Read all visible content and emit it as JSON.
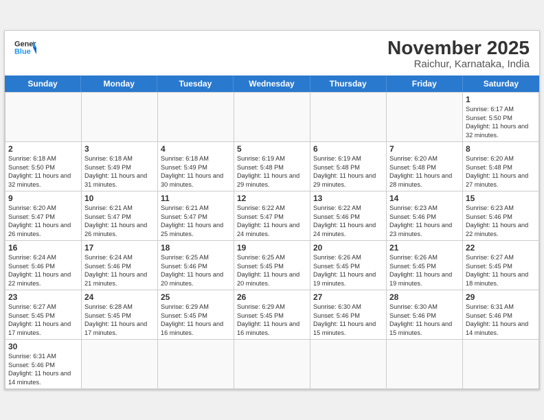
{
  "header": {
    "logo_general": "General",
    "logo_blue": "Blue",
    "month": "November 2025",
    "location": "Raichur, Karnataka, India"
  },
  "days": [
    "Sunday",
    "Monday",
    "Tuesday",
    "Wednesday",
    "Thursday",
    "Friday",
    "Saturday"
  ],
  "cells": [
    {
      "day": null,
      "empty": true
    },
    {
      "day": null,
      "empty": true
    },
    {
      "day": null,
      "empty": true
    },
    {
      "day": null,
      "empty": true
    },
    {
      "day": null,
      "empty": true
    },
    {
      "day": null,
      "empty": true
    },
    {
      "day": "1",
      "sunrise": "6:17 AM",
      "sunset": "5:50 PM",
      "daylight": "11 hours and 32 minutes."
    },
    {
      "day": "2",
      "sunrise": "6:18 AM",
      "sunset": "5:50 PM",
      "daylight": "11 hours and 32 minutes."
    },
    {
      "day": "3",
      "sunrise": "6:18 AM",
      "sunset": "5:49 PM",
      "daylight": "11 hours and 31 minutes."
    },
    {
      "day": "4",
      "sunrise": "6:18 AM",
      "sunset": "5:49 PM",
      "daylight": "11 hours and 30 minutes."
    },
    {
      "day": "5",
      "sunrise": "6:19 AM",
      "sunset": "5:48 PM",
      "daylight": "11 hours and 29 minutes."
    },
    {
      "day": "6",
      "sunrise": "6:19 AM",
      "sunset": "5:48 PM",
      "daylight": "11 hours and 29 minutes."
    },
    {
      "day": "7",
      "sunrise": "6:20 AM",
      "sunset": "5:48 PM",
      "daylight": "11 hours and 28 minutes."
    },
    {
      "day": "8",
      "sunrise": "6:20 AM",
      "sunset": "5:48 PM",
      "daylight": "11 hours and 27 minutes."
    },
    {
      "day": "9",
      "sunrise": "6:20 AM",
      "sunset": "5:47 PM",
      "daylight": "11 hours and 26 minutes."
    },
    {
      "day": "10",
      "sunrise": "6:21 AM",
      "sunset": "5:47 PM",
      "daylight": "11 hours and 26 minutes."
    },
    {
      "day": "11",
      "sunrise": "6:21 AM",
      "sunset": "5:47 PM",
      "daylight": "11 hours and 25 minutes."
    },
    {
      "day": "12",
      "sunrise": "6:22 AM",
      "sunset": "5:47 PM",
      "daylight": "11 hours and 24 minutes."
    },
    {
      "day": "13",
      "sunrise": "6:22 AM",
      "sunset": "5:46 PM",
      "daylight": "11 hours and 24 minutes."
    },
    {
      "day": "14",
      "sunrise": "6:23 AM",
      "sunset": "5:46 PM",
      "daylight": "11 hours and 23 minutes."
    },
    {
      "day": "15",
      "sunrise": "6:23 AM",
      "sunset": "5:46 PM",
      "daylight": "11 hours and 22 minutes."
    },
    {
      "day": "16",
      "sunrise": "6:24 AM",
      "sunset": "5:46 PM",
      "daylight": "11 hours and 22 minutes."
    },
    {
      "day": "17",
      "sunrise": "6:24 AM",
      "sunset": "5:46 PM",
      "daylight": "11 hours and 21 minutes."
    },
    {
      "day": "18",
      "sunrise": "6:25 AM",
      "sunset": "5:46 PM",
      "daylight": "11 hours and 20 minutes."
    },
    {
      "day": "19",
      "sunrise": "6:25 AM",
      "sunset": "5:45 PM",
      "daylight": "11 hours and 20 minutes."
    },
    {
      "day": "20",
      "sunrise": "6:26 AM",
      "sunset": "5:45 PM",
      "daylight": "11 hours and 19 minutes."
    },
    {
      "day": "21",
      "sunrise": "6:26 AM",
      "sunset": "5:45 PM",
      "daylight": "11 hours and 19 minutes."
    },
    {
      "day": "22",
      "sunrise": "6:27 AM",
      "sunset": "5:45 PM",
      "daylight": "11 hours and 18 minutes."
    },
    {
      "day": "23",
      "sunrise": "6:27 AM",
      "sunset": "5:45 PM",
      "daylight": "11 hours and 17 minutes."
    },
    {
      "day": "24",
      "sunrise": "6:28 AM",
      "sunset": "5:45 PM",
      "daylight": "11 hours and 17 minutes."
    },
    {
      "day": "25",
      "sunrise": "6:29 AM",
      "sunset": "5:45 PM",
      "daylight": "11 hours and 16 minutes."
    },
    {
      "day": "26",
      "sunrise": "6:29 AM",
      "sunset": "5:45 PM",
      "daylight": "11 hours and 16 minutes."
    },
    {
      "day": "27",
      "sunrise": "6:30 AM",
      "sunset": "5:46 PM",
      "daylight": "11 hours and 15 minutes."
    },
    {
      "day": "28",
      "sunrise": "6:30 AM",
      "sunset": "5:46 PM",
      "daylight": "11 hours and 15 minutes."
    },
    {
      "day": "29",
      "sunrise": "6:31 AM",
      "sunset": "5:46 PM",
      "daylight": "11 hours and 14 minutes."
    },
    {
      "day": "30",
      "sunrise": "6:31 AM",
      "sunset": "5:46 PM",
      "daylight": "11 hours and 14 minutes."
    },
    {
      "day": null,
      "empty": true
    },
    {
      "day": null,
      "empty": true
    },
    {
      "day": null,
      "empty": true
    },
    {
      "day": null,
      "empty": true
    },
    {
      "day": null,
      "empty": true
    },
    {
      "day": null,
      "empty": true
    }
  ],
  "labels": {
    "sunrise": "Sunrise:",
    "sunset": "Sunset:",
    "daylight": "Daylight:"
  }
}
